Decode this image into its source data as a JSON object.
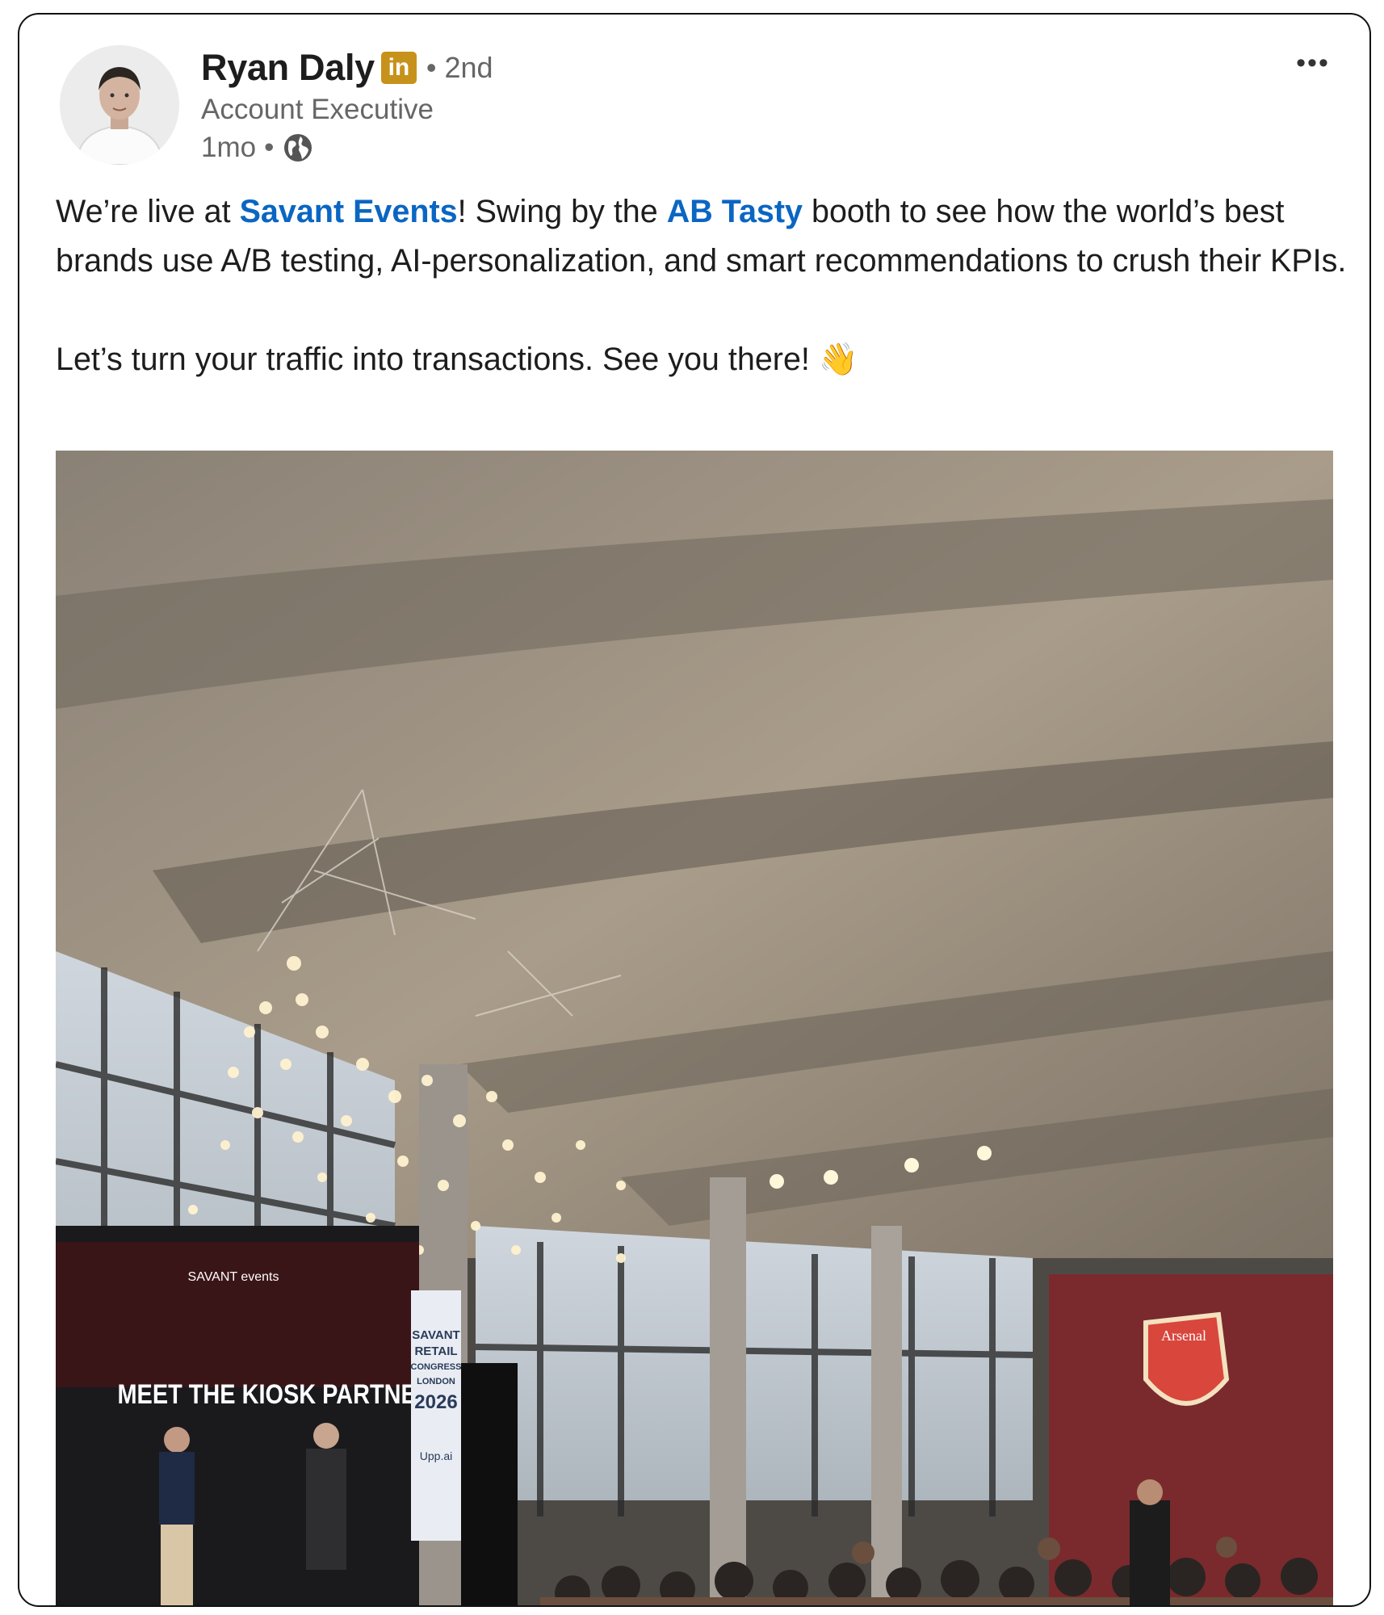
{
  "post": {
    "author": {
      "name": "Ryan Daly",
      "badge_icon": "linkedin-icon",
      "badge_text": "in",
      "degree": "2nd",
      "headline": "Account Executive",
      "time": "1mo",
      "visibility_icon": "globe-icon"
    },
    "menu_label": "•••",
    "text": {
      "line1_a": "We’re live at ",
      "link1": "Savant Events",
      "line1_b": "! Swing by the ",
      "link2": "AB Tasty",
      "line1_c": " booth to see how the world’s best brands use A/B testing, AI-personalization, and smart recommendations to crush their KPIs.",
      "line2": "Let’s turn your traffic into transactions. See you there! 👋"
    },
    "image": {
      "screen_logo": "SAVANT events",
      "screen_heading": "MEET THE KIOSK PARTNERS",
      "banner_lines": [
        "SAVANT",
        "RETAIL",
        "CONGRESS",
        "LONDON",
        "2026"
      ],
      "banner_footer": "Upp.ai",
      "crest_text": "Arsenal"
    }
  },
  "colors": {
    "link": "#0a66c2",
    "badge": "#c7921b",
    "secondary_text": "#666666"
  }
}
